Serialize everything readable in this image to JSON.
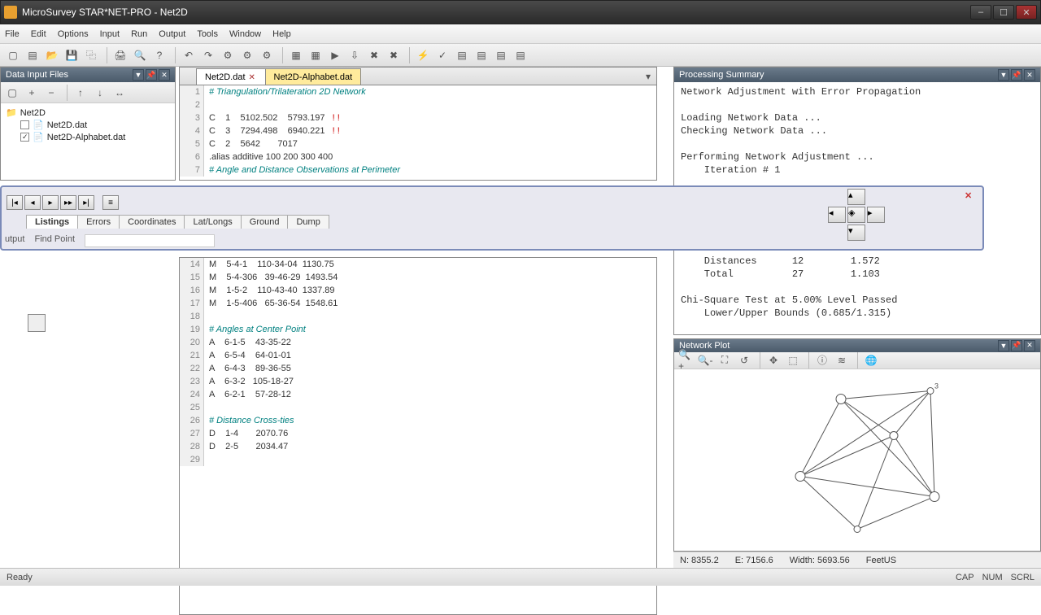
{
  "titlebar": {
    "text": "MicroSurvey STAR*NET-PRO - Net2D"
  },
  "menu": [
    "File",
    "Edit",
    "Options",
    "Input",
    "Run",
    "Output",
    "Tools",
    "Window",
    "Help"
  ],
  "panels": {
    "data_input": {
      "title": "Data Input Files"
    },
    "summary": {
      "title": "Processing Summary"
    },
    "netplot": {
      "title": "Network Plot"
    }
  },
  "tree": {
    "root": "Net2D",
    "files": [
      {
        "name": "Net2D.dat",
        "checked": false
      },
      {
        "name": "Net2D-Alphabet.dat",
        "checked": true
      }
    ]
  },
  "tabs": {
    "active": "Net2D.dat",
    "secondary": "Net2D-Alphabet.dat"
  },
  "code_upper": [
    {
      "n": 1,
      "t": "# Triangulation/Trilateration 2D Network",
      "c": true
    },
    {
      "n": 2,
      "t": ""
    },
    {
      "n": 3,
      "t": "C    1    5102.502    5793.197   ! !",
      "e": true
    },
    {
      "n": 4,
      "t": "C    3    7294.498    6940.221   ! !",
      "e": true
    },
    {
      "n": 5,
      "t": "C    2    5642       7017"
    },
    {
      "n": 6,
      "t": ".alias additive 100 200 300 400"
    },
    {
      "n": 7,
      "t": "# Angle and Distance Observations at Perimeter",
      "c": true
    }
  ],
  "code_lower": [
    {
      "n": 14,
      "t": "M    5-4-1    110-34-04  1130.75"
    },
    {
      "n": 15,
      "t": "M    5-4-306   39-46-29  1493.54"
    },
    {
      "n": 16,
      "t": "M    1-5-2    110-43-40  1337.89"
    },
    {
      "n": 17,
      "t": "M    1-5-406   65-36-54  1548.61"
    },
    {
      "n": 18,
      "t": ""
    },
    {
      "n": 19,
      "t": "# Angles at Center Point",
      "c": true
    },
    {
      "n": 20,
      "t": "A    6-1-5    43-35-22"
    },
    {
      "n": 21,
      "t": "A    6-5-4    64-01-01"
    },
    {
      "n": 22,
      "t": "A    6-4-3    89-36-55"
    },
    {
      "n": 23,
      "t": "A    6-3-2   105-18-27"
    },
    {
      "n": 24,
      "t": "A    6-2-1    57-28-12"
    },
    {
      "n": 25,
      "t": ""
    },
    {
      "n": 26,
      "t": "# Distance Cross-ties",
      "c": true
    },
    {
      "n": 27,
      "t": "D    1-4       2070.76"
    },
    {
      "n": 28,
      "t": "D    2-5       2034.47"
    },
    {
      "n": 29,
      "t": ""
    }
  ],
  "summary": [
    "Network Adjustment with Error Propagation",
    "",
    "Loading Network Data ...",
    "Checking Network Data ...",
    "",
    "Performing Network Adjustment ...",
    "    Iteration # 1",
    "",
    "",
    "",
    "",
    "",
    "",
    "    Distances      12        1.572",
    "    Total          27        1.103",
    "",
    "Chi-Square Test at 5.00% Level Passed",
    "    Lower/Upper Bounds (0.685/1.315)"
  ],
  "lower_tabs": [
    "Listings",
    "Errors",
    "Coordinates",
    "Lat/Longs",
    "Ground",
    "Dump"
  ],
  "bottom": {
    "output_label": "utput",
    "find_label": "Find Point"
  },
  "plot_status": {
    "n": "N: 8355.2",
    "e": "E: 7156.6",
    "w": "Width: 5693.56",
    "u": "FeetUS"
  },
  "statusbar": {
    "ready": "Ready",
    "cap": "CAP",
    "num": "NUM",
    "scrl": "SCRL"
  }
}
